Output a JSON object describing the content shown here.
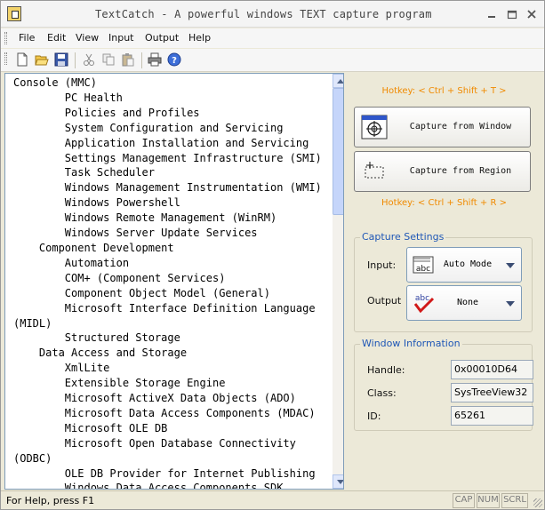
{
  "window": {
    "title": "TextCatch - A powerful windows TEXT capture program",
    "controls": [
      "minimize",
      "maximize",
      "close"
    ]
  },
  "menu": [
    "File",
    "Edit",
    "View",
    "Input",
    "Output",
    "Help"
  ],
  "toolbar": {
    "icons": [
      "new-file-icon",
      "open-folder-icon",
      "save-icon",
      "cut-icon",
      "copy-icon",
      "paste-icon",
      "print-icon",
      "help-icon"
    ]
  },
  "tree": {
    "lines": [
      "Console (MMC)",
      "        PC Health",
      "        Policies and Profiles",
      "        System Configuration and Servicing",
      "        Application Installation and Servicing",
      "        Settings Management Infrastructure (SMI)",
      "        Task Scheduler",
      "        Windows Management Instrumentation (WMI)",
      "        Windows Powershell",
      "        Windows Remote Management (WinRM)",
      "        Windows Server Update Services",
      "    Component Development",
      "        Automation",
      "        COM+ (Component Services)",
      "        Component Object Model (General)",
      "        Microsoft Interface Definition Language",
      "(MIDL)",
      "        Structured Storage",
      "    Data Access and Storage",
      "        XmlLite",
      "        Extensible Storage Engine",
      "        Microsoft ActiveX Data Objects (ADO)",
      "        Microsoft Data Access Components (MDAC)",
      "        Microsoft OLE DB",
      "        Microsoft Open Database Connectivity",
      "(ODBC)",
      "        OLE DB Provider for Internet Publishing",
      "        Windows Data Access Components SDK"
    ]
  },
  "capture": {
    "hotkey_window": "Hotkey: < Ctrl + Shift + T >",
    "window_button": "Capture from Window",
    "region_button": "Capture from Region",
    "hotkey_region": "Hotkey: < Ctrl + Shift + R >"
  },
  "settings": {
    "title": "Capture Settings",
    "input_label": "Input:",
    "input_value": "Auto Mode",
    "output_label": "Output",
    "output_value": "None"
  },
  "info": {
    "title": "Window Information",
    "handle_label": "Handle:",
    "handle_value": "0x00010D64",
    "class_label": "Class:",
    "class_value": "SysTreeView32",
    "id_label": "ID:",
    "id_value": "65261"
  },
  "status": {
    "text": "For Help, press F1",
    "cap": "CAP",
    "num": "NUM",
    "scrl": "SCRL"
  }
}
